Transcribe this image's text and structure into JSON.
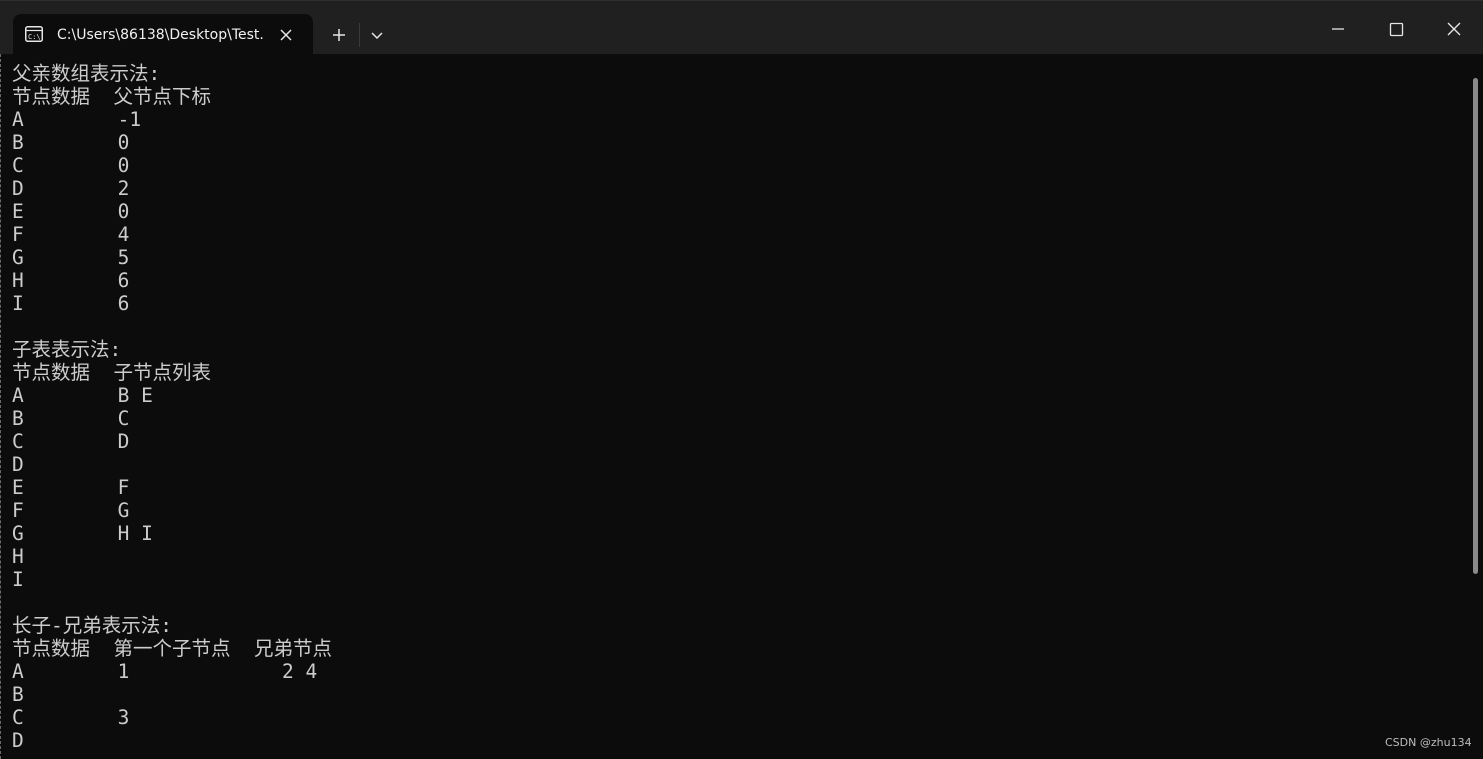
{
  "window": {
    "tab_title": "C:\\Users\\86138\\Desktop\\Test.",
    "icons": {
      "tab": "terminal-icon",
      "close_tab": "close-icon",
      "new_tab": "plus-icon",
      "dropdown": "chevron-down-icon",
      "minimize": "minimize-icon",
      "maximize": "maximize-icon",
      "close_window": "close-icon"
    }
  },
  "terminal": {
    "lines": [
      "父亲数组表示法:",
      "节点数据  父节点下标",
      "A        -1",
      "B        0",
      "C        0",
      "D        2",
      "E        0",
      "F        4",
      "G        5",
      "H        6",
      "I        6",
      "",
      "子表表示法:",
      "节点数据  子节点列表",
      "A        B E",
      "B        C",
      "C        D",
      "D",
      "E        F",
      "F        G",
      "G        H I",
      "H",
      "I",
      "",
      "长子-兄弟表示法:",
      "节点数据  第一个子节点  兄弟节点",
      "A        1             2 4",
      "B",
      "C        3",
      "D"
    ]
  },
  "watermark": "CSDN @zhu134",
  "colors": {
    "terminal_bg": "#0c0c0c",
    "titlebar_bg": "#202020",
    "text": "#cccccc"
  }
}
